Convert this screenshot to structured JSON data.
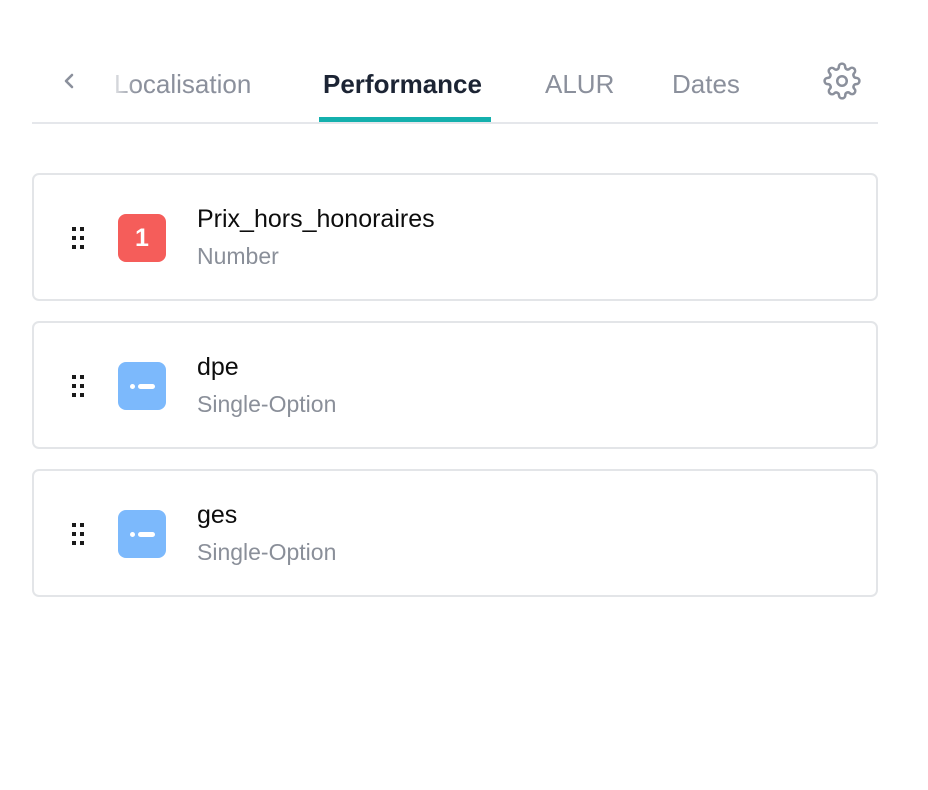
{
  "tabs": {
    "items": [
      {
        "label": "Localisation",
        "active": false
      },
      {
        "label": "Performance",
        "active": true
      },
      {
        "label": "ALUR",
        "active": false
      },
      {
        "label": "Dates",
        "active": false
      }
    ],
    "icons": {
      "scroll_left": "chevron-left-icon",
      "settings": "gear-icon"
    },
    "accent_color": "#14b0ad"
  },
  "fields": [
    {
      "name": "Prix_hors_honoraires",
      "type": "Number",
      "badge_text": "1",
      "badge_icon": "number-icon",
      "badge_color": "#f55d5a"
    },
    {
      "name": "dpe",
      "type": "Single-Option",
      "badge_icon": "single-option-icon",
      "badge_color": "#7cb9fc"
    },
    {
      "name": "ges",
      "type": "Single-Option",
      "badge_icon": "single-option-icon",
      "badge_color": "#7cb9fc"
    }
  ]
}
